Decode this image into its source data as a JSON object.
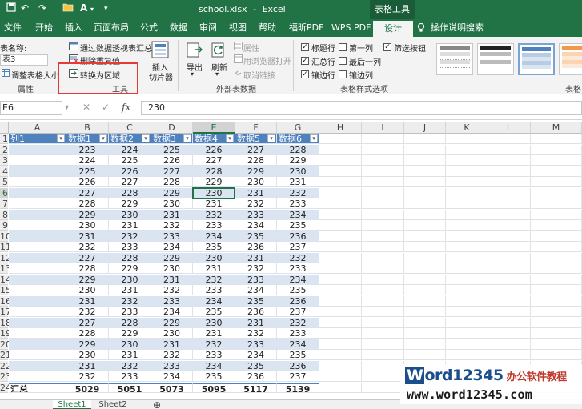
{
  "titlebar": {
    "file_name": "school.xlsx",
    "separator": "-",
    "app_name": "Excel",
    "context_tab": "表格工具",
    "bg_color": "#217346"
  },
  "tabs": {
    "items": [
      "文件",
      "开始",
      "插入",
      "页面布局",
      "公式",
      "数据",
      "审阅",
      "视图",
      "帮助",
      "福昕PDF",
      "WPS PDF",
      "设计"
    ],
    "active": "设计",
    "tell_me": "操作说明搜索"
  },
  "ribbon": {
    "properties": {
      "table_name_label": "表名称:",
      "table_name_value": "表3",
      "resize_label": "调整表格大小",
      "group_label": "属性"
    },
    "tools": {
      "pivot_summary": "通过数据透视表汇总",
      "remove_duplicates": "删除重复值",
      "convert_to_range": "转换为区域",
      "insert_slicer_line1": "插入",
      "insert_slicer_line2": "切片器",
      "group_label": "工具"
    },
    "external": {
      "export": "导出",
      "refresh": "刷新",
      "properties": "属性",
      "open_in_browser": "用浏览器打开",
      "unlink": "取消链接",
      "group_label": "外部表数据"
    },
    "style_options": {
      "header_row": "标题行",
      "first_column": "第一列",
      "filter_button": "筛选按钮",
      "total_row": "汇总行",
      "last_column": "最后一列",
      "banded_rows": "镶边行",
      "banded_columns": "镶边列",
      "group_label": "表格样式选项",
      "checked": {
        "header_row": true,
        "first_column": false,
        "filter_button": true,
        "total_row": true,
        "last_column": false,
        "banded_rows": true,
        "banded_columns": false
      }
    },
    "table_styles": {
      "group_label": "表格"
    }
  },
  "formula_bar": {
    "name_box": "E6",
    "cancel_icon": "✕",
    "enter_icon": "✓",
    "fx_label": "fx",
    "formula": "230"
  },
  "sheet": {
    "columns": [
      "A",
      "B",
      "C",
      "D",
      "E",
      "F",
      "G",
      "H",
      "I",
      "J",
      "K",
      "L",
      "M"
    ],
    "selected_column": "E",
    "row_numbers": [
      "1",
      "2",
      "3",
      "4",
      "5",
      "6",
      "7",
      "8",
      "9",
      "10",
      "11",
      "12",
      "13",
      "14",
      "15",
      "16",
      "17",
      "18",
      "19",
      "20",
      "21",
      "22",
      "23",
      "24"
    ],
    "selected_row": "6",
    "header": [
      "列1",
      "数据1",
      "数据2",
      "数据3",
      "数据4",
      "数据5",
      "数据6"
    ],
    "rows": [
      [
        "",
        "223",
        "224",
        "225",
        "226",
        "227",
        "228"
      ],
      [
        "",
        "224",
        "225",
        "226",
        "227",
        "228",
        "229"
      ],
      [
        "",
        "225",
        "226",
        "227",
        "228",
        "229",
        "230"
      ],
      [
        "",
        "226",
        "227",
        "228",
        "229",
        "230",
        "231"
      ],
      [
        "",
        "227",
        "228",
        "229",
        "230",
        "231",
        "232"
      ],
      [
        "",
        "228",
        "229",
        "230",
        "231",
        "232",
        "233"
      ],
      [
        "",
        "229",
        "230",
        "231",
        "232",
        "233",
        "234"
      ],
      [
        "",
        "230",
        "231",
        "232",
        "233",
        "234",
        "235"
      ],
      [
        "",
        "231",
        "232",
        "233",
        "234",
        "235",
        "236"
      ],
      [
        "",
        "232",
        "233",
        "234",
        "235",
        "236",
        "237"
      ],
      [
        "",
        "227",
        "228",
        "229",
        "230",
        "231",
        "232"
      ],
      [
        "",
        "228",
        "229",
        "230",
        "231",
        "232",
        "233"
      ],
      [
        "",
        "229",
        "230",
        "231",
        "232",
        "233",
        "234"
      ],
      [
        "",
        "230",
        "231",
        "232",
        "233",
        "234",
        "235"
      ],
      [
        "",
        "231",
        "232",
        "233",
        "234",
        "235",
        "236"
      ],
      [
        "",
        "232",
        "233",
        "234",
        "235",
        "236",
        "237"
      ],
      [
        "",
        "227",
        "228",
        "229",
        "230",
        "231",
        "232"
      ],
      [
        "",
        "228",
        "229",
        "230",
        "231",
        "232",
        "233"
      ],
      [
        "",
        "229",
        "230",
        "231",
        "232",
        "233",
        "234"
      ],
      [
        "",
        "230",
        "231",
        "232",
        "233",
        "234",
        "235"
      ],
      [
        "",
        "231",
        "232",
        "233",
        "234",
        "235",
        "236"
      ],
      [
        "",
        "232",
        "233",
        "234",
        "235",
        "236",
        "237"
      ]
    ],
    "total": [
      "汇总",
      "5029",
      "5051",
      "5073",
      "5095",
      "5117",
      "5139"
    ],
    "header_color": "#4f81bd",
    "band_color": "#dbe5f1"
  },
  "sheet_tabs": {
    "items": [
      "Sheet1",
      "Sheet2"
    ],
    "active": "Sheet1",
    "add_icon": "⊕"
  },
  "watermark": {
    "logo_w": "W",
    "logo_rest": "ord12345",
    "logo_tag": "办公软件教程",
    "url": "www.word12345.com"
  }
}
